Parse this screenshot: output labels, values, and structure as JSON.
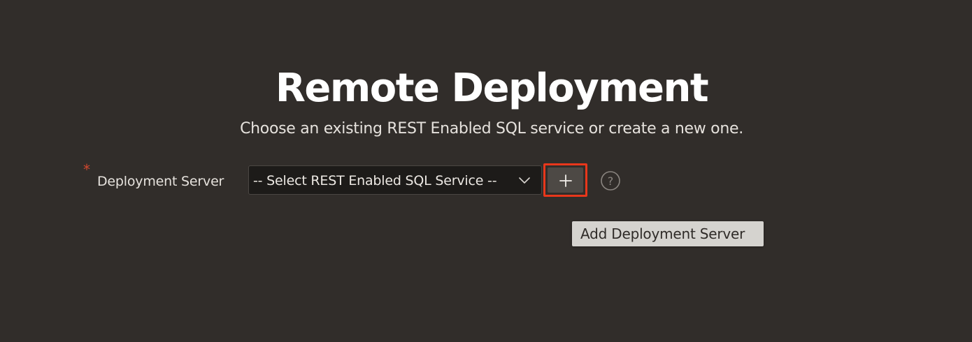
{
  "page": {
    "title": "Remote Deployment",
    "subtitle": "Choose an existing REST Enabled SQL service or create a new one."
  },
  "form": {
    "required_marker": "*",
    "deployment_server": {
      "label": "Deployment Server",
      "selected_value": "-- Select REST Enabled SQL Service --"
    },
    "add_button": {
      "icon": "plus-icon",
      "tooltip": "Add Deployment Server"
    },
    "help": {
      "icon": "question-circle-icon",
      "glyph": "?"
    }
  },
  "colors": {
    "background": "#312d2a",
    "highlight_border": "#e8371b",
    "required_star": "#d1472e",
    "tooltip_bg": "#d5d3cf"
  }
}
